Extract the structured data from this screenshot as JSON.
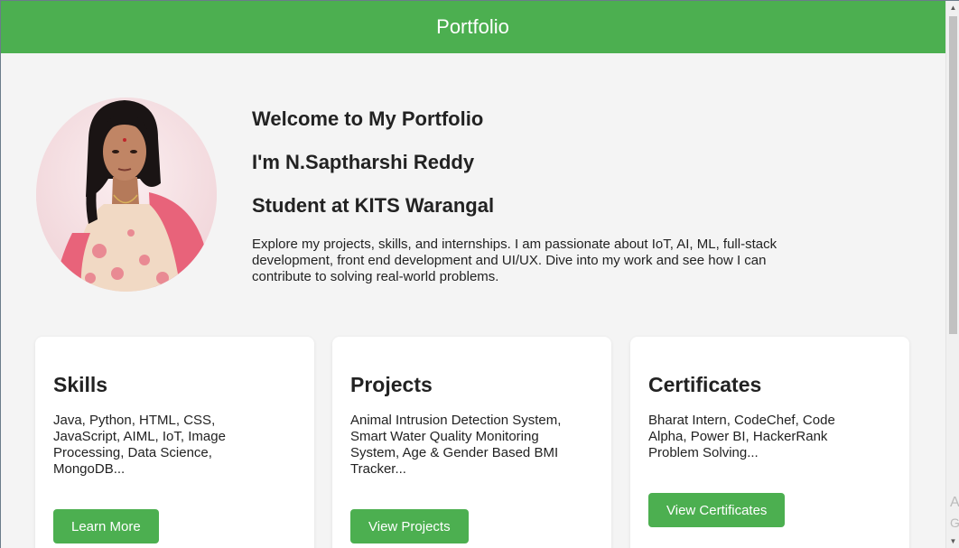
{
  "header": {
    "title": "Portfolio"
  },
  "intro": {
    "welcome": "Welcome to My Portfolio",
    "name": "I'm N.Saptharshi Reddy",
    "role": "Student at KITS Warangal",
    "description": "Explore my projects, skills, and internships. I am passionate about IoT, AI, ML, full-stack development, front end development and UI/UX. Dive into my work and see how I can contribute to solving real-world problems."
  },
  "cards": [
    {
      "title": "Skills",
      "text": "Java, Python, HTML, CSS, JavaScript, AIML, IoT, Image Processing, Data Science, MongoDB...",
      "button": "Learn More"
    },
    {
      "title": "Projects",
      "text": "Animal Intrusion Detection System, Smart Water Quality Monitoring System, Age & Gender Based BMI Tracker...",
      "button": "View Projects"
    },
    {
      "title": "Certificates",
      "text": "Bharat Intern, CodeChef, Code Alpha, Power BI, HackerRank Problem Solving...",
      "button": "View Certificates"
    }
  ],
  "icons": {
    "avatar": "profile-photo",
    "scroll_up": "triangle-up-icon",
    "scroll_down": "triangle-down-icon"
  },
  "colors": {
    "accent": "#4caf50",
    "background": "#f4f4f4",
    "card": "#ffffff"
  },
  "overlay": {
    "line1": "A",
    "line2": "G"
  }
}
